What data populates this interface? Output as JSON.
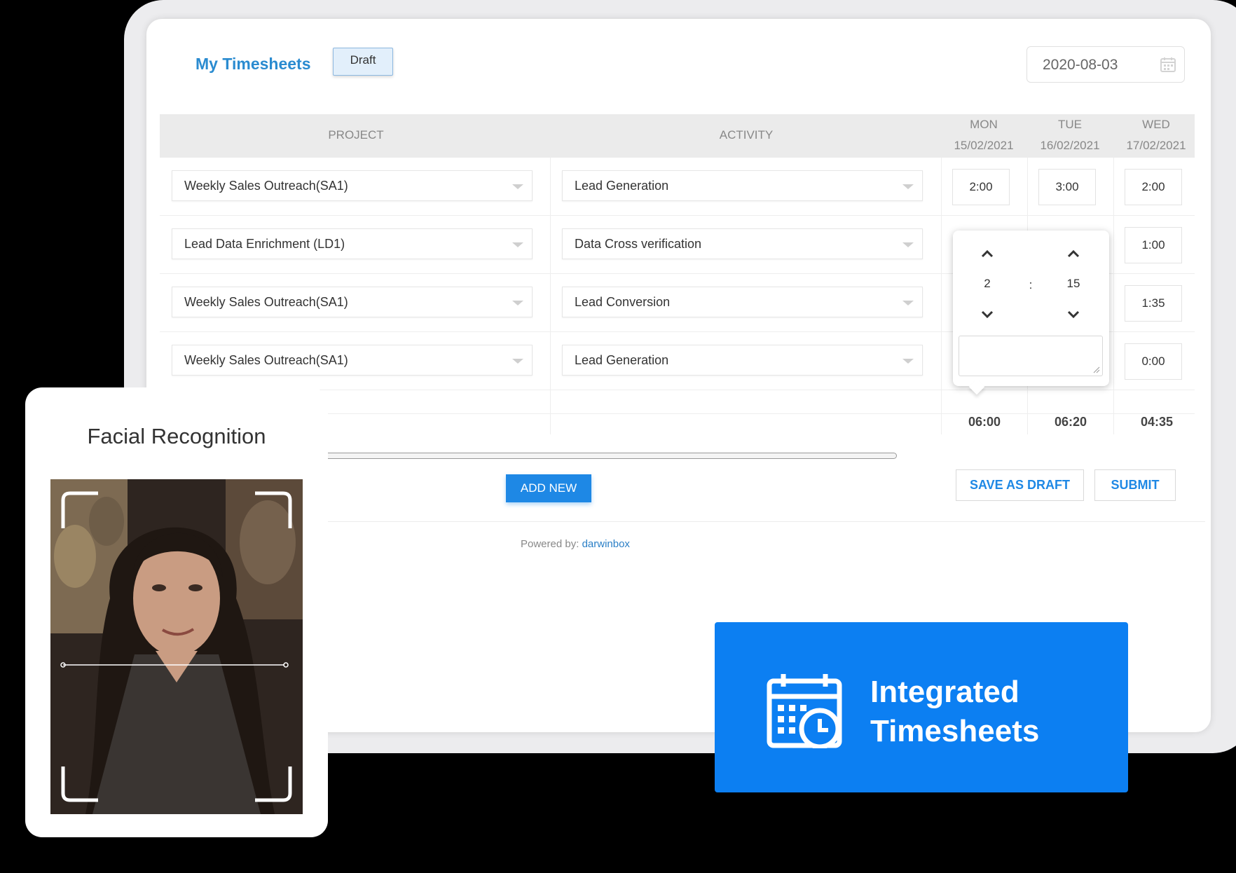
{
  "header": {
    "title": "My Timesheets",
    "status": "Draft",
    "date": "2020-08-03"
  },
  "table": {
    "columns": {
      "project": "PROJECT",
      "activity": "ACTIVITY",
      "days": [
        {
          "day": "MON",
          "date": "15/02/2021"
        },
        {
          "day": "TUE",
          "date": "16/02/2021"
        },
        {
          "day": "WED",
          "date": "17/02/2021"
        }
      ]
    },
    "rows": [
      {
        "project": "Weekly Sales Outreach(SA1)",
        "activity": "Lead Generation",
        "mon": "2:00",
        "tue": "3:00",
        "wed": "2:00"
      },
      {
        "project": "Lead Data Enrichment (LD1)",
        "activity": "Data Cross verification",
        "wed": "1:00"
      },
      {
        "project": "Weekly Sales Outreach(SA1)",
        "activity": "Lead Conversion",
        "wed": "1:35"
      },
      {
        "project": "Weekly Sales Outreach(SA1)",
        "activity": "Lead Generation",
        "wed": "0:00"
      }
    ],
    "totals": {
      "mon": "06:00",
      "tue": "06:20",
      "wed": "04:35"
    }
  },
  "time_picker": {
    "hours": "2",
    "separator": ":",
    "minutes": "15",
    "note": ""
  },
  "actions": {
    "add_new": "ADD NEW",
    "save_draft": "SAVE AS DRAFT",
    "submit": "SUBMIT"
  },
  "footer": {
    "powered_label": "Powered by:",
    "brand": "darwinbox"
  },
  "facial": {
    "title": "Facial Recognition"
  },
  "promo": {
    "line1": "Integrated",
    "line2": "Timesheets"
  },
  "colors": {
    "accent": "#1e88e5",
    "title": "#2a8bd0",
    "promo_bg": "#0c7ff2"
  },
  "icons": [
    "calendar-icon",
    "dropdown-arrow-icon",
    "chevron-up-icon",
    "chevron-down-icon",
    "calendar-clock-icon",
    "face-scan-frame-icon"
  ]
}
